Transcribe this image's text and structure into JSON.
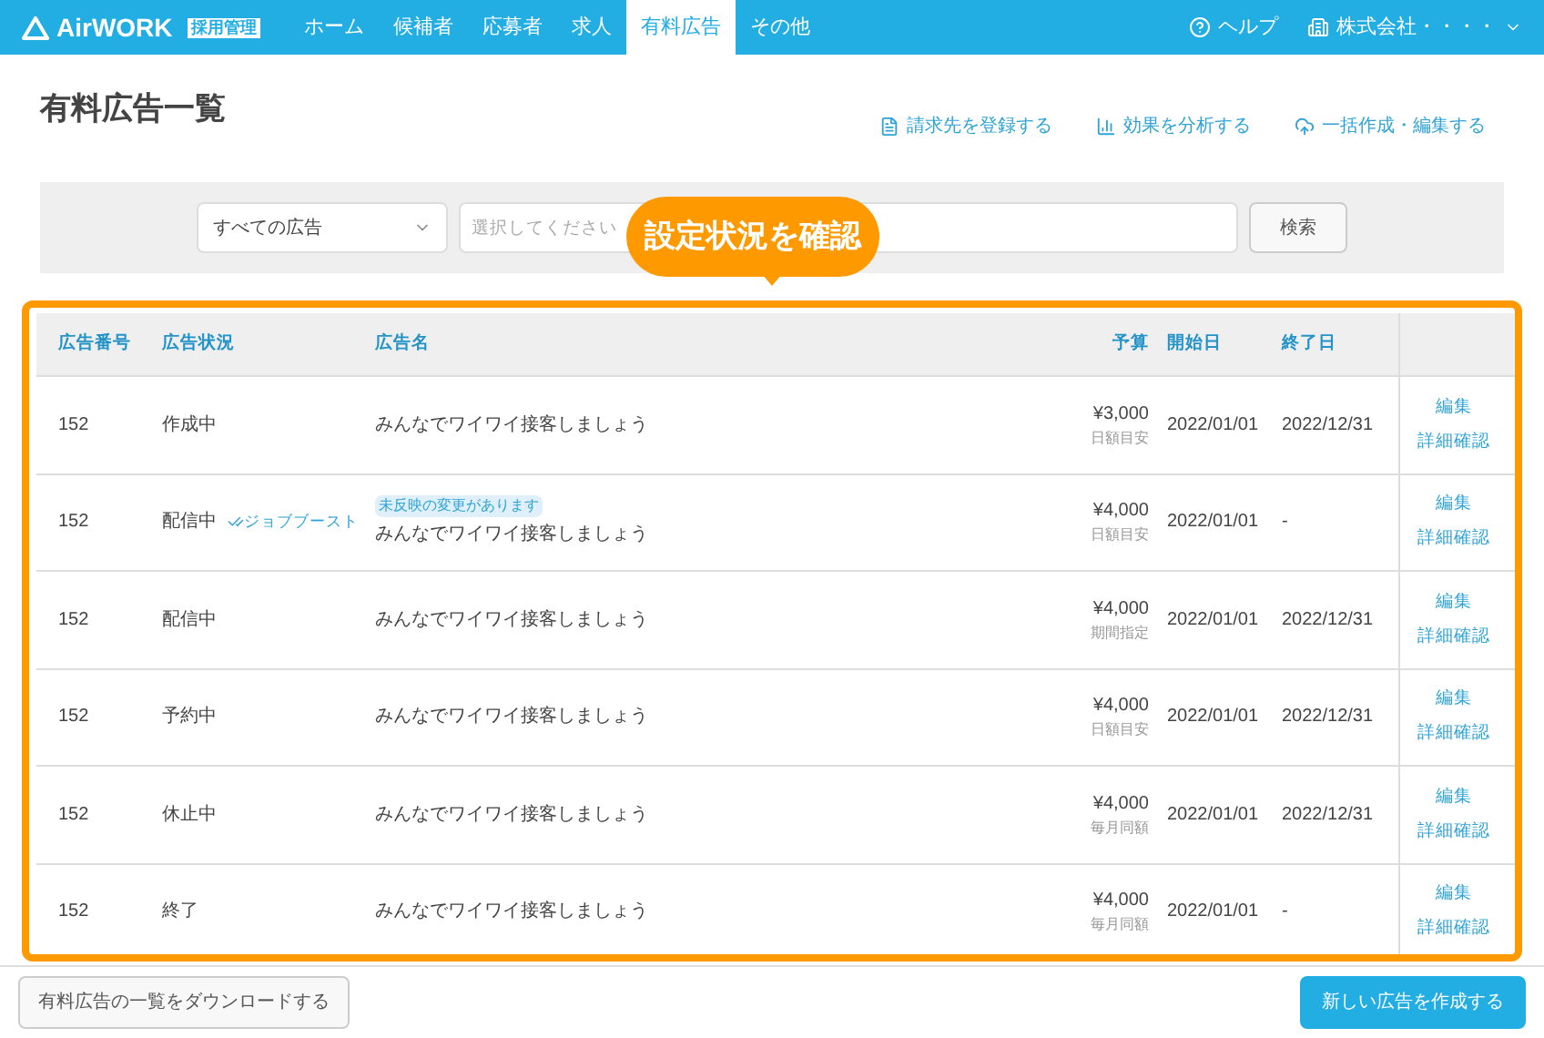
{
  "header": {
    "logo": "AirWORK",
    "logo_badge": "採用管理",
    "nav": [
      {
        "label": "ホーム",
        "selected": false
      },
      {
        "label": "候補者",
        "selected": false
      },
      {
        "label": "応募者",
        "selected": false
      },
      {
        "label": "求人",
        "selected": false
      },
      {
        "label": "有料広告",
        "selected": true
      },
      {
        "label": "その他",
        "selected": false
      }
    ],
    "help": "ヘルプ",
    "account": "株式会社・・・・"
  },
  "page": {
    "title": "有料広告一覧",
    "actions": [
      {
        "kind": "billing",
        "label": "請求先を登録する"
      },
      {
        "kind": "analyze",
        "label": "効果を分析する"
      },
      {
        "kind": "upload",
        "label": "一括作成・編集する"
      }
    ]
  },
  "filter": {
    "select": "すべての広告",
    "placeholder": "選択してください",
    "button": "検索"
  },
  "callout": "設定状況を確認",
  "table": {
    "columns": [
      "広告番号",
      "広告状況",
      "広告名",
      "予算",
      "開始日",
      "終了日"
    ],
    "rows": [
      {
        "id": "152",
        "status": "作成中",
        "name": "みんなでワイワイ接客しましょう",
        "budget": "¥3,000",
        "budget_type": "日額目安",
        "start": "2022/01/01",
        "end": "2022/12/31",
        "actions": [
          "編集",
          "詳細確認"
        ]
      },
      {
        "id": "152",
        "status": "配信中",
        "boost": "ジョブブースト",
        "notice": "未反映の変更があります",
        "name": "みんなでワイワイ接客しましょう",
        "budget": "¥4,000",
        "budget_type": "日額目安",
        "start": "2022/01/01",
        "end": "-",
        "actions": [
          "編集",
          "詳細確認"
        ]
      },
      {
        "id": "152",
        "status": "配信中",
        "name": "みんなでワイワイ接客しましょう",
        "budget": "¥4,000",
        "budget_type": "期間指定",
        "start": "2022/01/01",
        "end": "2022/12/31",
        "actions": [
          "編集",
          "詳細確認"
        ]
      },
      {
        "id": "152",
        "status": "予約中",
        "name": "みんなでワイワイ接客しましょう",
        "budget": "¥4,000",
        "budget_type": "日額目安",
        "start": "2022/01/01",
        "end": "2022/12/31",
        "actions": [
          "編集",
          "詳細確認"
        ]
      },
      {
        "id": "152",
        "status": "休止中",
        "name": "みんなでワイワイ接客しましょう",
        "budget": "¥4,000",
        "budget_type": "毎月同額",
        "start": "2022/01/01",
        "end": "2022/12/31",
        "actions": [
          "編集",
          "詳細確認"
        ]
      },
      {
        "id": "152",
        "status": "終了",
        "name": "みんなでワイワイ接客しましょう",
        "budget": "¥4,000",
        "budget_type": "毎月同額",
        "start": "2022/01/01",
        "end": "-",
        "actions": [
          "編集",
          "詳細確認"
        ]
      }
    ]
  },
  "footer": {
    "download": "有料広告の一覧をダウンロードする",
    "create": "新しい広告を作成する"
  }
}
